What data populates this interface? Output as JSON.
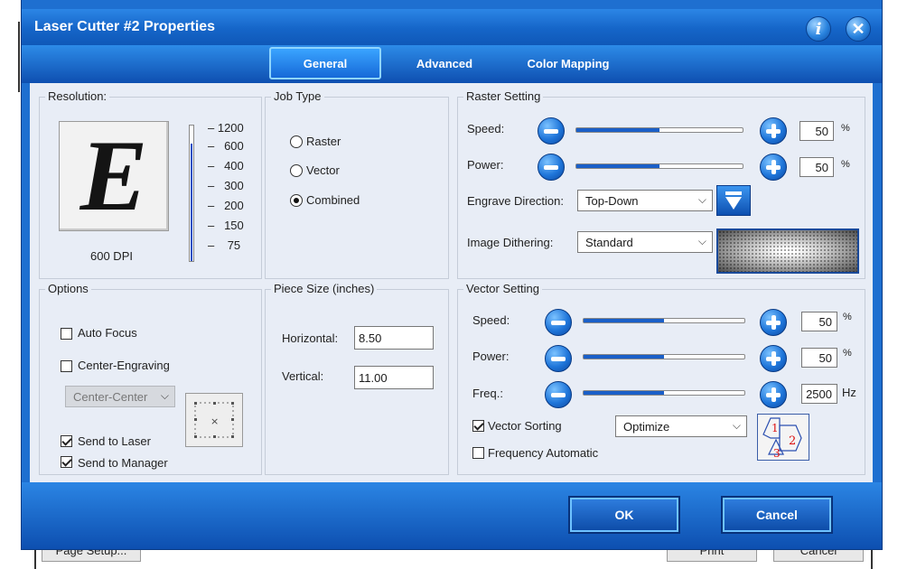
{
  "dialog": {
    "title": "Laser Cutter #2 Properties",
    "info_icon": "info-icon",
    "close_icon": "close-icon"
  },
  "tabs": [
    {
      "label": "General",
      "active": true
    },
    {
      "label": "Advanced",
      "active": false
    },
    {
      "label": "Color Mapping",
      "active": false
    }
  ],
  "resolution": {
    "group_label": "Resolution:",
    "preview_letter": "E",
    "current": "600 DPI",
    "levels": [
      "1200",
      "600",
      "400",
      "300",
      "200",
      "150",
      "75"
    ]
  },
  "job_type": {
    "group_label": "Job Type",
    "options": [
      {
        "label": "Raster",
        "selected": false
      },
      {
        "label": "Vector",
        "selected": false
      },
      {
        "label": "Combined",
        "selected": true
      }
    ]
  },
  "raster": {
    "group_label": "Raster Setting",
    "speed_label": "Speed:",
    "speed_value": "50",
    "speed_unit": "%",
    "speed_level": 0.5,
    "power_label": "Power:",
    "power_value": "50",
    "power_unit": "%",
    "power_level": 0.5,
    "engrave_direction_label": "Engrave Direction:",
    "engrave_direction_value": "Top-Down",
    "dithering_label": "Image Dithering:",
    "dithering_value": "Standard"
  },
  "options": {
    "group_label": "Options",
    "auto_focus": {
      "label": "Auto Focus",
      "checked": false
    },
    "center_engraving": {
      "label": "Center-Engraving",
      "checked": false
    },
    "center_select": "Center-Center",
    "send_to_laser": {
      "label": "Send to Laser",
      "checked": true
    },
    "send_to_manager": {
      "label": "Send to Manager",
      "checked": true
    }
  },
  "piece_size": {
    "group_label": "Piece Size (inches)",
    "horizontal_label": "Horizontal:",
    "horizontal_value": "8.50",
    "vertical_label": "Vertical:",
    "vertical_value": "11.00"
  },
  "vector": {
    "group_label": "Vector Setting",
    "speed_label": "Speed:",
    "speed_value": "50",
    "speed_unit": "%",
    "speed_level": 0.5,
    "power_label": "Power:",
    "power_value": "50",
    "power_unit": "%",
    "power_level": 0.5,
    "freq_label": "Freq.:",
    "freq_value": "2500",
    "freq_unit": "Hz",
    "freq_level": 0.5,
    "vector_sorting": {
      "label": "Vector Sorting",
      "checked": true
    },
    "sorting_value": "Optimize",
    "frequency_automatic": {
      "label": "Frequency Automatic",
      "checked": false
    }
  },
  "footer": {
    "ok_label": "OK",
    "cancel_label": "Cancel"
  },
  "background_window": {
    "page_setup": "Page Setup...",
    "print": "Print",
    "cancel": "Cancel"
  }
}
